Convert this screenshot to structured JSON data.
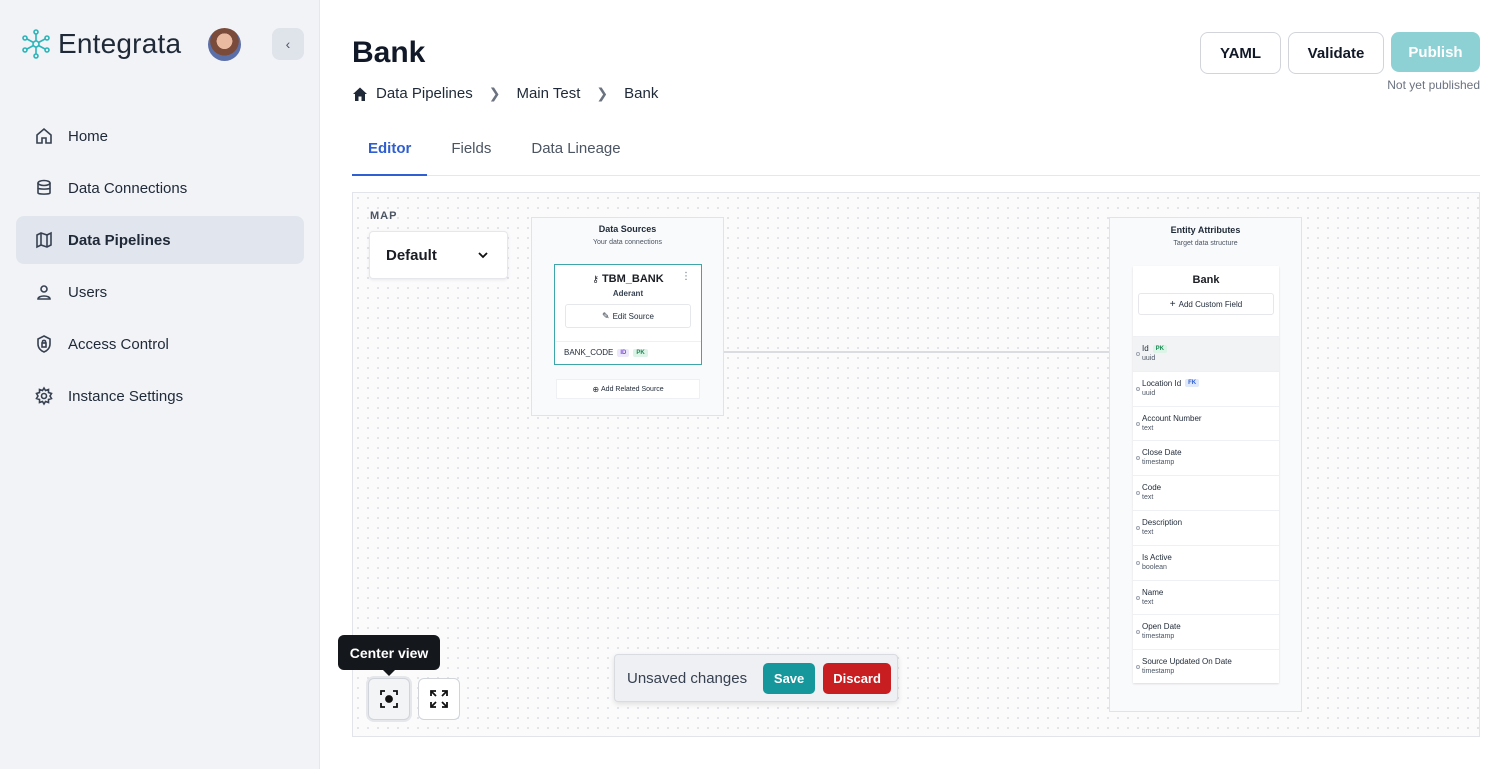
{
  "app": {
    "name": "Entegrata"
  },
  "sidebar": {
    "collapse_icon": "chevron-left-icon",
    "items": [
      {
        "label": "Home",
        "icon": "home-icon"
      },
      {
        "label": "Data Connections",
        "icon": "database-icon"
      },
      {
        "label": "Data Pipelines",
        "icon": "map-icon",
        "active": true
      },
      {
        "label": "Users",
        "icon": "user-icon"
      },
      {
        "label": "Access Control",
        "icon": "shield-lock-icon"
      },
      {
        "label": "Instance Settings",
        "icon": "gear-icon"
      }
    ]
  },
  "header": {
    "title": "Bank",
    "breadcrumb": [
      "Data Pipelines",
      "Main Test",
      "Bank"
    ],
    "buttons": {
      "yaml": "YAML",
      "validate": "Validate",
      "publish": "Publish"
    },
    "publish_status": "Not yet published"
  },
  "tabs": [
    {
      "label": "Editor",
      "active": true
    },
    {
      "label": "Fields"
    },
    {
      "label": "Data Lineage"
    }
  ],
  "canvas": {
    "map_label": "MAP",
    "map_select": "Default",
    "data_sources": {
      "title": "Data Sources",
      "subtitle": "Your data connections",
      "source": {
        "name": "TBM_BANK",
        "connection": "Aderant",
        "edit_label": "Edit Source",
        "field": {
          "name": "BANK_CODE",
          "badges": [
            "ID",
            "PK"
          ]
        }
      },
      "add_related": "Add Related Source"
    },
    "entity": {
      "title": "Entity Attributes",
      "subtitle": "Target data structure",
      "name": "Bank",
      "add_custom": "Add Custom Field",
      "attributes": [
        {
          "name": "Id",
          "type": "uuid",
          "badge": "PK"
        },
        {
          "name": "Location Id",
          "type": "uuid",
          "badge": "FK"
        },
        {
          "name": "Account Number",
          "type": "text"
        },
        {
          "name": "Close Date",
          "type": "timestamp"
        },
        {
          "name": "Code",
          "type": "text"
        },
        {
          "name": "Description",
          "type": "text"
        },
        {
          "name": "Is Active",
          "type": "boolean"
        },
        {
          "name": "Name",
          "type": "text"
        },
        {
          "name": "Open Date",
          "type": "timestamp"
        },
        {
          "name": "Source Updated On Date",
          "type": "timestamp"
        }
      ]
    },
    "tooltip": "Center view",
    "unsaved": {
      "text": "Unsaved changes",
      "save": "Save",
      "discard": "Discard"
    }
  },
  "colors": {
    "accent": "#16979b",
    "tab_active": "#2f5fd0",
    "discard": "#c81e22",
    "publish_disabled": "#8dd1d4"
  }
}
